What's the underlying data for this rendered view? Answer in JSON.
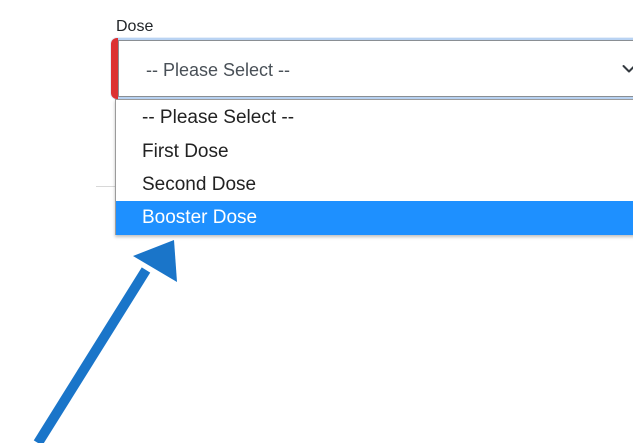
{
  "field": {
    "label": "Dose"
  },
  "select": {
    "value": "-- Please Select --",
    "icon": "chevron-down-icon"
  },
  "dropdown": {
    "options": [
      "-- Please Select --",
      "First Dose",
      "Second Dose",
      "Booster Dose"
    ],
    "selected_index": 3,
    "highlight_color": "#1e90ff"
  },
  "colors": {
    "validation_accent": "#dc3232",
    "annotation_arrow": "#1a75c9"
  }
}
